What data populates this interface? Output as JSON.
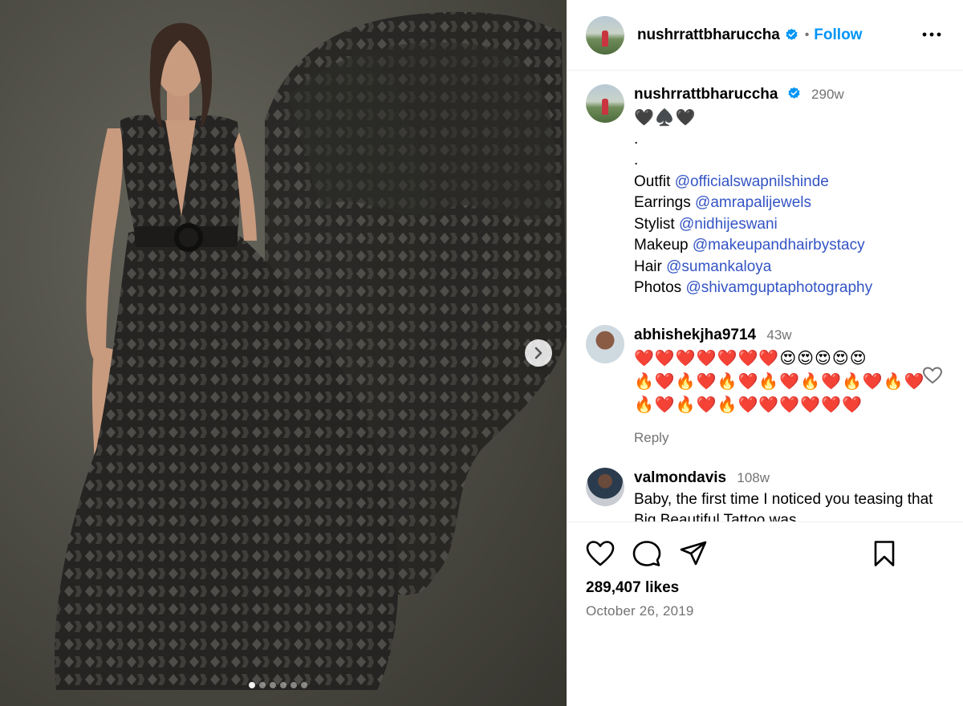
{
  "post": {
    "username": "nushrrattbharuccha",
    "separator": "•",
    "follow_label": "Follow",
    "slide_count": 6,
    "active_slide": 1
  },
  "caption": {
    "username": "nushrrattbharuccha",
    "time": "290w",
    "emoji_line": "🖤♠️🖤",
    "dot1": ".",
    "dot2": ".",
    "credits": [
      {
        "label": "Outfit",
        "handle": "@officialswapnilshinde"
      },
      {
        "label": "Earrings",
        "handle": "@amrapalijewels"
      },
      {
        "label": "Stylist",
        "handle": "@nidhijeswani"
      },
      {
        "label": "Makeup",
        "handle": "@makeupandhairbystacy"
      },
      {
        "label": "Hair",
        "handle": "@sumankaloya"
      },
      {
        "label": "Photos",
        "handle": "@shivamguptaphotography"
      }
    ]
  },
  "comments": [
    {
      "username": "abhishekjha9714",
      "time": "43w",
      "lines": [
        "❤️❤️❤️❤️❤️❤️❤️😍😍😍😍😍",
        "🔥❤️🔥❤️🔥❤️🔥❤️🔥❤️🔥❤️🔥❤️",
        "🔥❤️🔥❤️🔥❤️❤️❤️❤️❤️❤️"
      ],
      "reply_label": "Reply"
    },
    {
      "username": "valmondavis",
      "time": "108w",
      "text": "Baby, the first time I noticed you teasing that Big Beautiful Tattoo was"
    }
  ],
  "footer": {
    "likes": "289,407 likes",
    "date": "October 26, 2019"
  },
  "colors": {
    "accent": "#0095f6",
    "mention": "#3454c5",
    "muted": "#737373",
    "verified": "#0095f6"
  },
  "icons": [
    "verified-badge-icon",
    "more-options-icon",
    "heart-icon",
    "comment-icon",
    "share-icon",
    "save-icon",
    "chevron-right-icon"
  ]
}
